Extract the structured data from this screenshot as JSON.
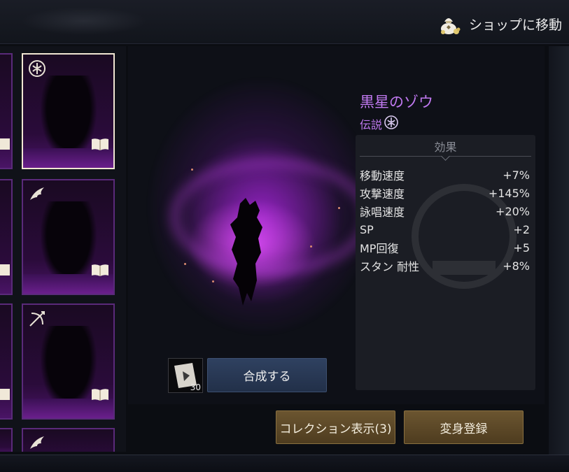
{
  "header": {
    "shop_label": "ショップに移動",
    "shop_icon": "money-bag-icon"
  },
  "collection": {
    "cards": [
      {
        "type_icon": "emblem-icon",
        "selected": true
      },
      {
        "type_icon": "feather-wing-icon",
        "selected": false
      },
      {
        "type_icon": "bow-icon",
        "selected": false
      },
      {
        "type_icon": "feather-wing-icon",
        "selected": false
      }
    ]
  },
  "monster": {
    "name": "黒星のゾウ",
    "rarity": "伝説",
    "rarity_icon": "legendary-emblem-icon"
  },
  "effects": {
    "heading": "効果",
    "rows": [
      {
        "label": "移動速度",
        "value": "+7%"
      },
      {
        "label": "攻撃速度",
        "value": "+145%"
      },
      {
        "label": "詠唱速度",
        "value": "+20%"
      },
      {
        "label": "SP",
        "value": "+2"
      },
      {
        "label": "MP回復",
        "value": "+5"
      },
      {
        "label": "スタン 耐性",
        "value": "+8%"
      }
    ]
  },
  "synthesis": {
    "item_count": "30",
    "button_label": "合成する"
  },
  "footer_buttons": {
    "collection_label": "コレクション表示(3)",
    "register_label": "変身登録"
  },
  "colors": {
    "legendary_purple": "#c079f0",
    "gold_button": "#6b5530",
    "blue_button": "#2f4160"
  }
}
